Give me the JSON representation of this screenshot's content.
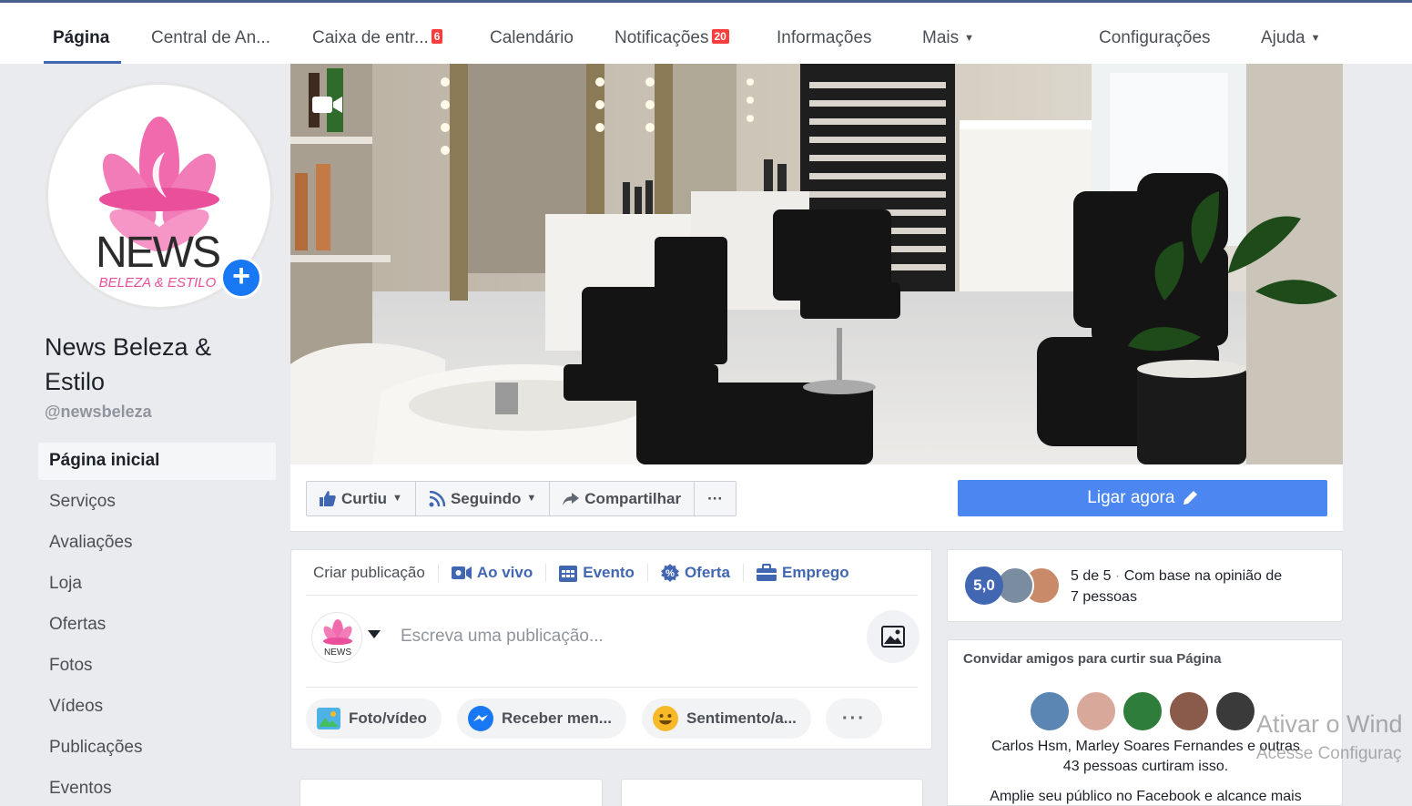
{
  "nav": {
    "tabs": [
      {
        "label": "Página"
      },
      {
        "label": "Central de An..."
      },
      {
        "label": "Caixa de entr...",
        "badge": "6"
      },
      {
        "label": "Calendário"
      },
      {
        "label": "Notificações",
        "badge": "20"
      },
      {
        "label": "Informações"
      },
      {
        "label": "Mais"
      },
      {
        "label": "Configurações"
      },
      {
        "label": "Ajuda"
      }
    ]
  },
  "profile": {
    "logo_text": "NEWS",
    "logo_sub": "BELEZA & ESTILO",
    "name": "News Beleza & Estilo",
    "handle": "@newsbeleza"
  },
  "sidebar": {
    "items": [
      {
        "label": "Página inicial"
      },
      {
        "label": "Serviços"
      },
      {
        "label": "Avaliações"
      },
      {
        "label": "Loja"
      },
      {
        "label": "Ofertas"
      },
      {
        "label": "Fotos"
      },
      {
        "label": "Vídeos"
      },
      {
        "label": "Publicações"
      },
      {
        "label": "Eventos"
      }
    ]
  },
  "actions": {
    "like": "Curtiu",
    "follow": "Seguindo",
    "share": "Compartilhar",
    "more": "···",
    "call": "Ligar agora"
  },
  "composer": {
    "tabs": [
      "Criar publicação",
      "Ao vivo",
      "Evento",
      "Oferta",
      "Emprego"
    ],
    "placeholder": "Escreva uma publicação...",
    "pills": [
      "Foto/vídeo",
      "Receber men...",
      "Sentimento/a...",
      "···"
    ]
  },
  "rating": {
    "score": "5,0",
    "line1": "5 de 5",
    "line1_sep": " · ",
    "line1_rest": "Com base na opinião de",
    "line2": "7 pessoas"
  },
  "invite": {
    "title": "Convidar amigos para curtir sua Página",
    "names": "Carlos Hsm, Marley Soares Fernandes e outras",
    "count": "43 pessoas curtiram isso.",
    "more": "Amplie seu público no Facebook e alcance mais"
  },
  "watermark": {
    "line1": "Ativar o Wind",
    "line2": "Acesse Configuraç"
  },
  "colors": {
    "brand": "#4267b2",
    "call_button": "#4c86f0",
    "badge": "#fa3e3e",
    "logo_pink": "#e94f9b"
  }
}
